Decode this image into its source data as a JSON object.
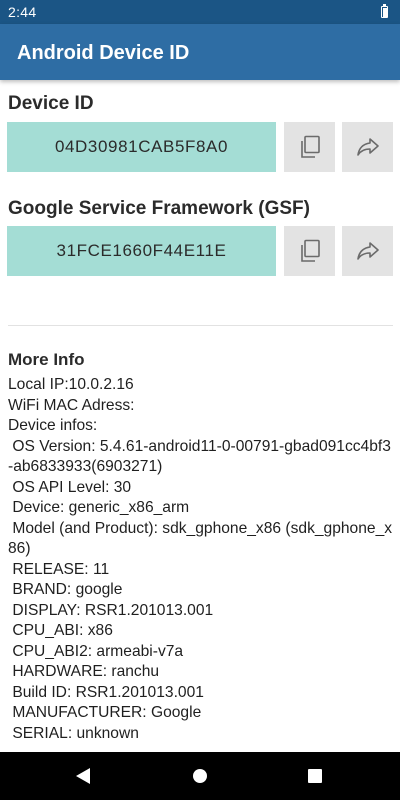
{
  "status": {
    "time": "2:44"
  },
  "app": {
    "title": "Android Device ID"
  },
  "device_id": {
    "label": "Device ID",
    "value": "04D30981CAB5F8A0"
  },
  "gsf": {
    "label": "Google Service Framework (GSF)",
    "value": "31FCE1660F44E11E"
  },
  "icons": {
    "copy": "copy-icon",
    "share": "share-icon"
  },
  "colors": {
    "app_bar": "#2e6da4",
    "status_bar": "#1b5585",
    "id_box": "#a4ddd5",
    "icon_button": "#e3e3e3"
  },
  "more_info": {
    "title": "More Info",
    "lines": [
      "Local IP:10.0.2.16",
      "WiFi MAC Adress:",
      "Device infos:",
      " OS Version: 5.4.61-android11-0-00791-gbad091cc4bf3-ab6833933(6903271)",
      " OS API Level: 30",
      " Device: generic_x86_arm",
      " Model (and Product): sdk_gphone_x86 (sdk_gphone_x86)",
      " RELEASE: 11",
      " BRAND: google",
      " DISPLAY: RSR1.201013.001",
      " CPU_ABI: x86",
      " CPU_ABI2: armeabi-v7a",
      " HARDWARE: ranchu",
      " Build ID: RSR1.201013.001",
      " MANUFACTURER: Google",
      " SERIAL: unknown"
    ]
  }
}
